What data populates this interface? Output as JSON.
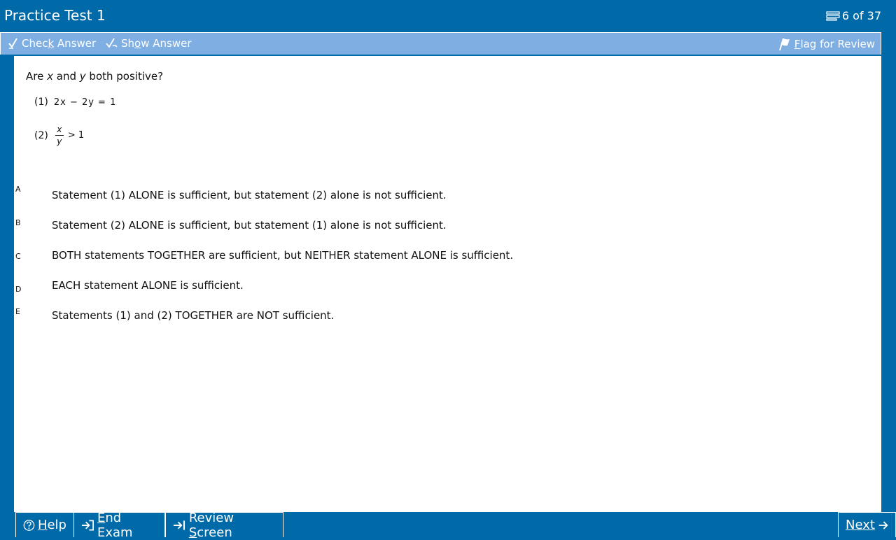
{
  "header": {
    "title": "Practice Test 1",
    "progress": "6 of 37"
  },
  "toolbar": {
    "check_prefix": "Chec",
    "check_key": "k",
    "check_suffix": " Answer",
    "show_prefix": "Sh",
    "show_key": "o",
    "show_suffix": "w Answer",
    "flag_key": "F",
    "flag_suffix": "lag for Review"
  },
  "question": {
    "prefix": "Are ",
    "var_x": "x",
    "middle": " and ",
    "var_y": "y",
    "suffix": " both positive?",
    "statement1_label": "(1)",
    "statement1_math": "2x − 2y = 1",
    "statement2_label": "(2)",
    "statement2_num": "x",
    "statement2_den": "y",
    "statement2_rest": "> 1"
  },
  "options": [
    {
      "letter": "A",
      "text": "Statement (1) ALONE is sufficient, but statement (2) alone is not sufficient."
    },
    {
      "letter": "B",
      "text": "Statement (2) ALONE is sufficient, but statement (1) alone is not sufficient."
    },
    {
      "letter": "C",
      "text": "BOTH statements TOGETHER are sufficient, but NEITHER statement ALONE is sufficient."
    },
    {
      "letter": "D",
      "text": "EACH statement ALONE is sufficient."
    },
    {
      "letter": "E",
      "text": "Statements (1) and (2) TOGETHER are NOT sufficient."
    }
  ],
  "footer": {
    "help_key": "H",
    "help_suffix": "elp",
    "end_key": "E",
    "end_suffix": "nd Exam",
    "review_prefix": "Review ",
    "review_key": "S",
    "review_suffix": "creen",
    "next_key": "N",
    "next_suffix": "ext"
  },
  "colors": {
    "frame": "#006aa9",
    "toolbar": "#7eaee2",
    "content": "#ffffff"
  },
  "icons": [
    "list-icon",
    "check-answer-icon",
    "show-answer-icon",
    "flag-icon",
    "help-icon",
    "end-exam-icon",
    "review-screen-icon",
    "next-arrow-icon"
  ]
}
